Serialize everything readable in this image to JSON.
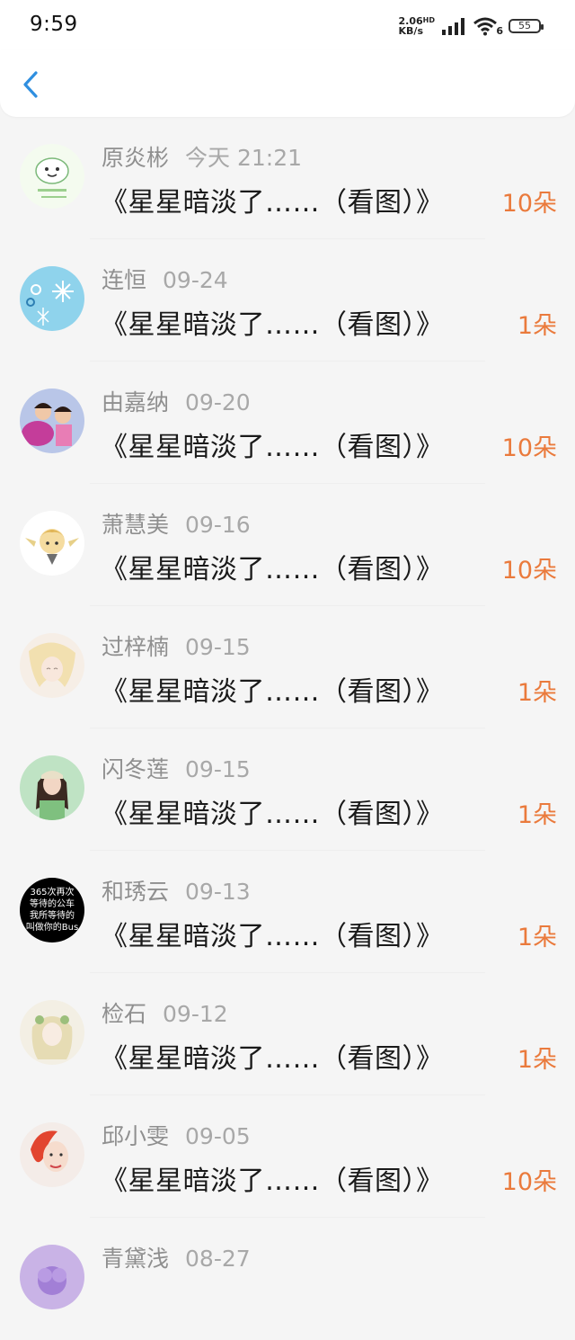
{
  "status_bar": {
    "time": "9:59",
    "net_speed": "2.06",
    "net_unit": "KB/s",
    "hd": "HD",
    "wifi_badge": "6",
    "battery": "55"
  },
  "nav": {
    "back_icon": "chevron-left-icon",
    "accent_color": "#2f8fe0"
  },
  "colors": {
    "count": "#ea7a3c",
    "name": "#8f8f8f"
  },
  "items": [
    {
      "name": "原炎彬",
      "date": "今天 21:21",
      "title": "《星星暗淡了……（看图）》",
      "count": "10朵"
    },
    {
      "name": "连恒",
      "date": "09-24",
      "title": "《星星暗淡了……（看图）》",
      "count": "1朵"
    },
    {
      "name": "由嘉纳",
      "date": "09-20",
      "title": "《星星暗淡了……（看图）》",
      "count": "10朵"
    },
    {
      "name": "萧慧美",
      "date": "09-16",
      "title": "《星星暗淡了……（看图）》",
      "count": "10朵"
    },
    {
      "name": "过梓楠",
      "date": "09-15",
      "title": "《星星暗淡了……（看图）》",
      "count": "1朵"
    },
    {
      "name": "闪冬莲",
      "date": "09-15",
      "title": "《星星暗淡了……（看图）》",
      "count": "1朵"
    },
    {
      "name": "和琇云",
      "date": "09-13",
      "title": "《星星暗淡了……（看图）》",
      "count": "1朵",
      "avatar_text": [
        "365次再次",
        "等待的公车",
        "我所等待的",
        "叫做你的Bus"
      ]
    },
    {
      "name": "检石",
      "date": "09-12",
      "title": "《星星暗淡了……（看图）》",
      "count": "1朵"
    },
    {
      "name": "邱小雯",
      "date": "09-05",
      "title": "《星星暗淡了……（看图）》",
      "count": "10朵"
    },
    {
      "name": "青黛浅",
      "date": "08-27",
      "title": "",
      "count": ""
    }
  ]
}
